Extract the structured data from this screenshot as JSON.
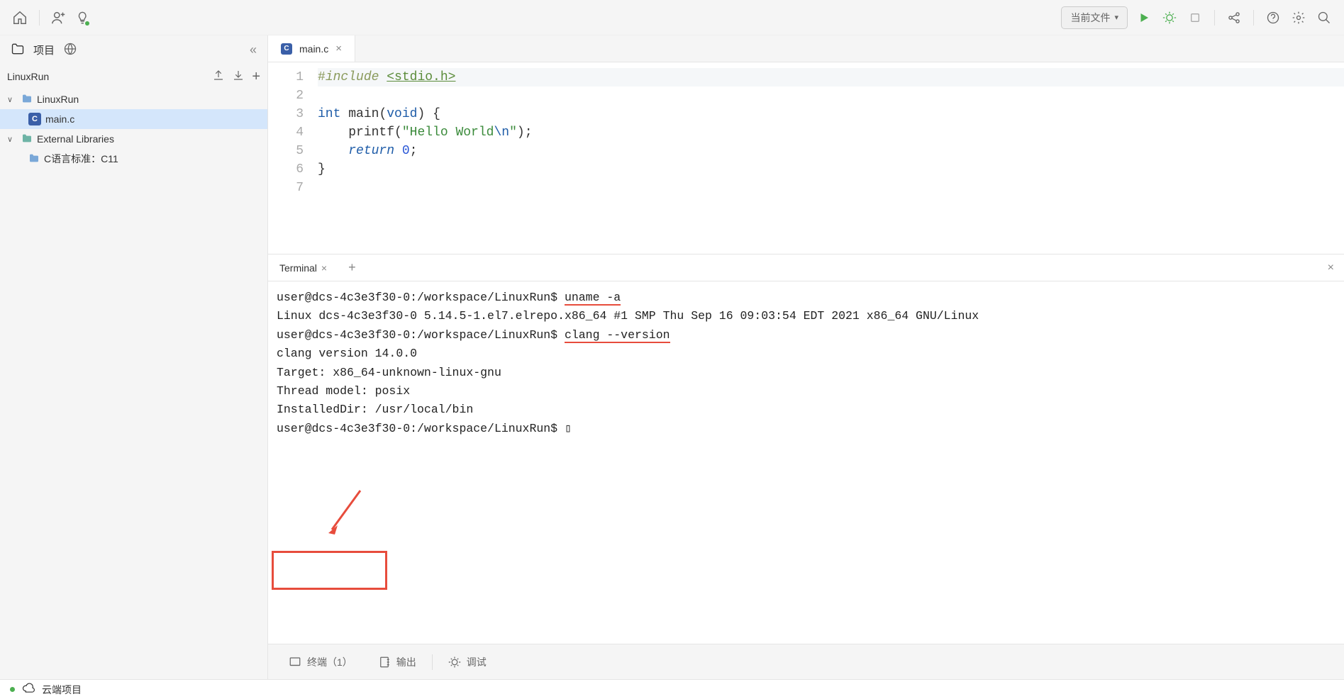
{
  "toolbar": {
    "run_config_label": "当前文件"
  },
  "sidebar": {
    "project_tab_label": "项目",
    "project_name": "LinuxRun",
    "tree": {
      "root_folder": "LinuxRun",
      "file_main": "main.c",
      "external_libs": "External Libraries",
      "c_std": "C语言标准：C11"
    }
  },
  "editor": {
    "tab_filename": "main.c",
    "gutter": {
      "l1": "1",
      "l2": "2",
      "l3": "3",
      "l4": "4",
      "l5": "5",
      "l6": "6",
      "l7": "7"
    },
    "code": {
      "l1_pp": "#",
      "l1_inc": "include",
      "l1_sp": " ",
      "l1_hdr": "<stdio.h>",
      "l3_type_int": "int",
      "l3_fn": "main",
      "l3_paren_open": "(",
      "l3_void": "void",
      "l3_rest": ") {",
      "l4_indent": "    ",
      "l4_printf": "printf",
      "l4_paren_open": "(",
      "l4_str_a": "\"Hello World",
      "l4_esc": "\\n",
      "l4_str_b": "\"",
      "l4_rest": ");",
      "l5_indent": "    ",
      "l5_ret": "return",
      "l5_sp": " ",
      "l5_zero": "0",
      "l5_semi": ";",
      "l6_brace": "}"
    }
  },
  "terminal": {
    "tab_label": "Terminal",
    "lines": {
      "p1_prompt": "user@dcs-4c3e3f30-0:/workspace/LinuxRun$ ",
      "p1_cmd": "uname -a",
      "l2": "Linux dcs-4c3e3f30-0 5.14.5-1.el7.elrepo.x86_64 #1 SMP Thu Sep 16 09:03:54 EDT 2021 x86_64 GNU/Linux",
      "p3_prompt": "user@dcs-4c3e3f30-0:/workspace/LinuxRun$ ",
      "p3_cmd": "clang --version",
      "l4": "clang version 14.0.0",
      "l5": "Target: x86_64-unknown-linux-gnu",
      "l6": "Thread model: posix",
      "l7": "InstalledDir: /usr/local/bin",
      "p8_prompt": "user@dcs-4c3e3f30-0:/workspace/LinuxRun$ ",
      "cursor": "▯"
    }
  },
  "bottom_tabs": {
    "terminal_label": "终端（1）",
    "output_label": "输出",
    "debug_label": "调试"
  },
  "status_bar": {
    "cloud_project_label": "云端项目"
  }
}
